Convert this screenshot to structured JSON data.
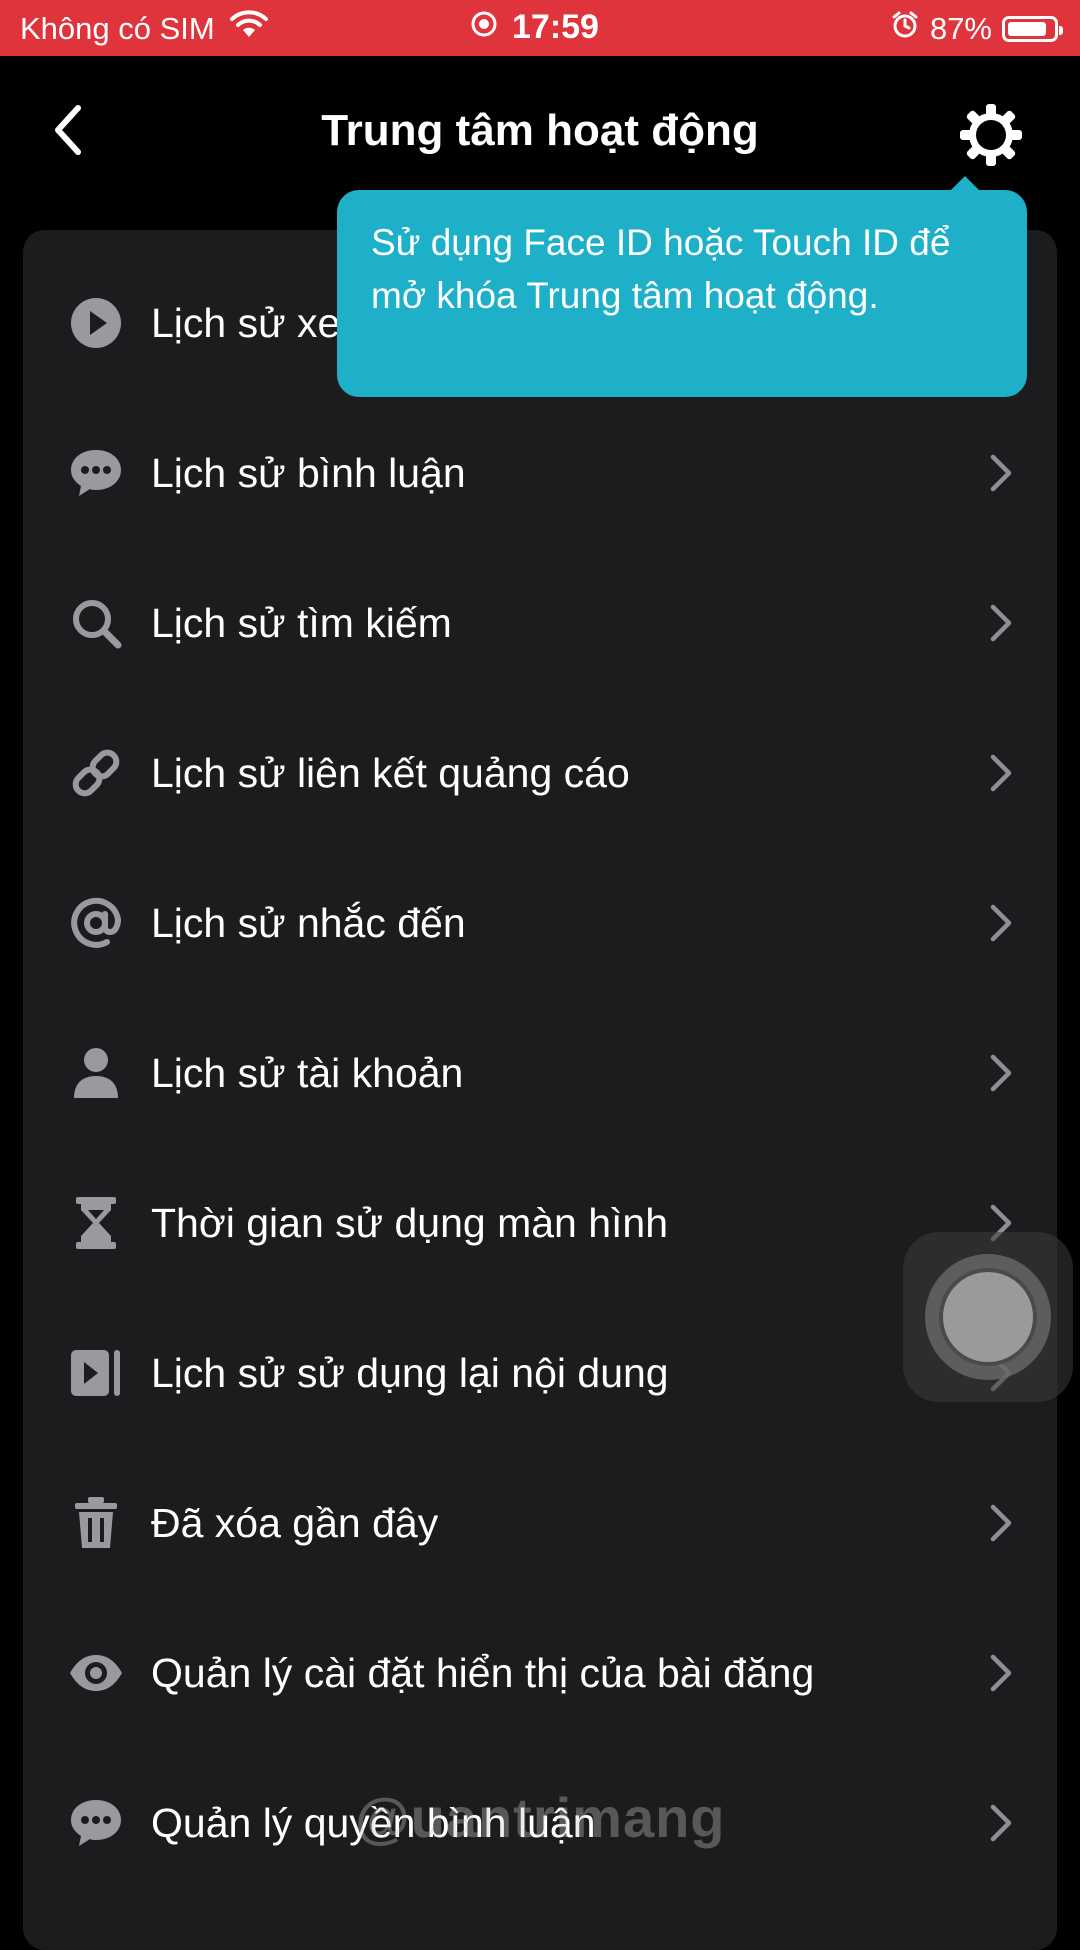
{
  "status_bar": {
    "carrier": "Không có SIM",
    "time": "17:59",
    "battery_percent": "87%",
    "battery_level": 0.87,
    "icons": [
      "wifi-icon",
      "screen-record-icon",
      "alarm-icon",
      "battery-icon"
    ]
  },
  "header": {
    "title": "Trung tâm hoạt động",
    "back_icon": "chevron-left-icon",
    "settings_icon": "gear-icon"
  },
  "tooltip": {
    "text": "Sử dụng Face ID hoặc Touch ID để mở khóa Trung tâm hoạt động."
  },
  "menu": {
    "items": [
      {
        "label": "Lịch sử xem",
        "icon": "play-circle-icon"
      },
      {
        "label": "Lịch sử bình luận",
        "icon": "comment-bubble-icon"
      },
      {
        "label": "Lịch sử tìm kiếm",
        "icon": "search-icon"
      },
      {
        "label": "Lịch sử liên kết quảng cáo",
        "icon": "link-icon"
      },
      {
        "label": "Lịch sử nhắc đến",
        "icon": "at-sign-icon"
      },
      {
        "label": "Lịch sử tài khoản",
        "icon": "person-icon"
      },
      {
        "label": "Thời gian sử dụng màn hình",
        "icon": "hourglass-icon"
      },
      {
        "label": "Lịch sử sử dụng lại nội dung",
        "icon": "video-reuse-icon"
      },
      {
        "label": "Đã xóa gần đây",
        "icon": "trash-icon"
      },
      {
        "label": "Quản lý cài đặt hiển thị của bài đăng",
        "icon": "eye-icon"
      },
      {
        "label": "Quản lý quyền bình luận",
        "icon": "comment-bubble-icon"
      }
    ]
  },
  "watermark": "@uantrimang",
  "colors": {
    "status_bar_bg": "#e0343c",
    "background": "#000000",
    "panel_bg": "#1c1c1e",
    "tooltip_bg": "#1fb0c9",
    "icon_gray": "#9a9a9e",
    "chevron_gray": "#8e8e93"
  }
}
